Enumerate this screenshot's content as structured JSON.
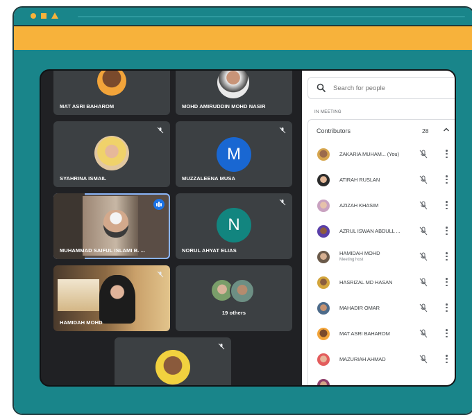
{
  "search": {
    "placeholder": "Search for people"
  },
  "panel": {
    "section_label": "IN MEETING",
    "contributors_label": "Contributors",
    "contributors_count": "28"
  },
  "tiles": [
    {
      "name": "MAT ASRI BAHAROM"
    },
    {
      "name": "MOHD AMIRUDDIN MOHD NASIR"
    },
    {
      "name": "SYAHRINA ISMAIL"
    },
    {
      "name": "MUZZALEENA MUSA",
      "letter": "M"
    },
    {
      "name": "MUHAMMAD SAIFUL ISLAMI B. ..."
    },
    {
      "name": "NORUL AHYAT ELIAS",
      "letter": "N"
    },
    {
      "name": "HAMIDAH MOHD"
    },
    {
      "name": "19 others"
    },
    {
      "name": ""
    }
  ],
  "participants": [
    {
      "name": "ZAKARIA MUHAM...",
      "you": "(You)",
      "role": ""
    },
    {
      "name": "ATIRAH RUSLAN",
      "role": ""
    },
    {
      "name": "AZIZAH KHASIM",
      "role": ""
    },
    {
      "name": "AZRUL ISWAN ABDULL ...",
      "role": ""
    },
    {
      "name": "HAMIDAH MOHD",
      "role": "Meeting host"
    },
    {
      "name": "HASRIZAL MD HASAN",
      "role": ""
    },
    {
      "name": "MAHADIR OMAR",
      "role": ""
    },
    {
      "name": "MAT ASRI BAHAROM",
      "role": ""
    },
    {
      "name": "MAZURIAH AHMAD",
      "role": ""
    }
  ],
  "colors": {
    "teal": "#19858a",
    "orange": "#f7b23b",
    "meet_bg": "#202124",
    "tile_bg": "#3c4043",
    "avatar_m": "#1967d2",
    "avatar_n": "#12857f",
    "speaking_outline": "#8ab4f8"
  }
}
